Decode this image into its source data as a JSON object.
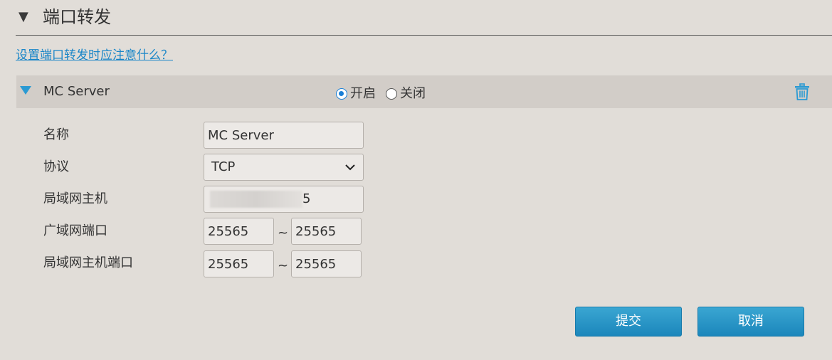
{
  "section": {
    "arrow": "▼",
    "title": "端口转发",
    "help_link": "设置端口转发时应注意什么？"
  },
  "rule": {
    "name": "MC Server",
    "status_options": [
      {
        "label": "开启",
        "checked": true
      },
      {
        "label": "关闭",
        "checked": false
      }
    ],
    "delete_icon": "trash-icon"
  },
  "form": {
    "name_label": "名称",
    "name_value": "MC Server",
    "protocol_label": "协议",
    "protocol_value": "TCP",
    "lan_host_label": "局域网主机",
    "lan_host_visible_tail": "5",
    "wan_port_label": "广域网端口",
    "wan_port_start": "25565",
    "wan_port_end": "25565",
    "lan_port_label": "局域网主机端口",
    "lan_port_start": "25565",
    "lan_port_end": "25565",
    "range_separator": "~"
  },
  "buttons": {
    "submit": "提交",
    "cancel": "取消"
  },
  "colors": {
    "accent": "#2b9ad3",
    "link": "#1a86c8",
    "button": "#1b86bb",
    "background": "#e1ddd8",
    "bar": "#d2cdc8"
  }
}
